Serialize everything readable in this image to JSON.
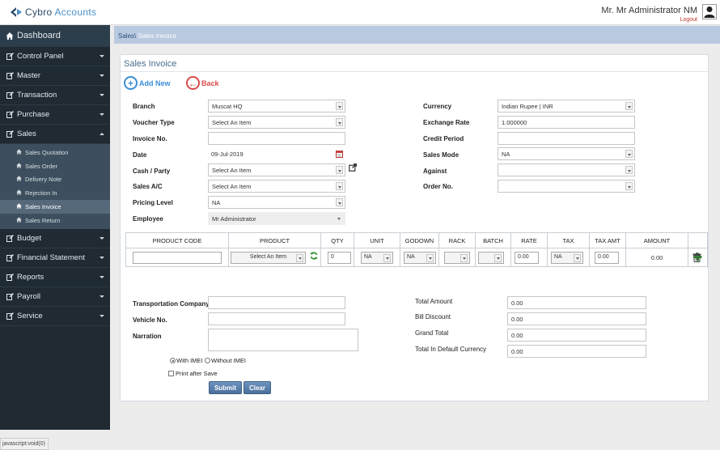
{
  "header": {
    "brand_main": "Cybro",
    "brand_accent": "Accounts",
    "user_name": "Mr. Mr Administrator NM",
    "logout": "Logout"
  },
  "sidebar": {
    "dashboard": "Dashboard",
    "items_top": [
      "Control Panel",
      "Master",
      "Transaction",
      "Purchase",
      "Sales"
    ],
    "sales_sub": [
      "Sales Quotation",
      "Sales Order",
      "Delivery Note",
      "Rejection In",
      "Sales Invoice",
      "Sales Return"
    ],
    "items_bottom": [
      "Budget",
      "Financial Statement",
      "Reports",
      "Payroll",
      "Service"
    ]
  },
  "status_text": "javascript:void(0)",
  "breadcrumb": {
    "parent": "Sales\\",
    "current": "Sales Invoice"
  },
  "panel": {
    "title": "Sales Invoice",
    "add_new": "Add New",
    "back": "Back"
  },
  "form": {
    "branch_label": "Branch",
    "branch_value": "Muscat HQ",
    "voucher_type_label": "Voucher Type",
    "voucher_type_value": "Select An Item",
    "invoice_no_label": "Invoice No.",
    "invoice_no_value": "",
    "date_label": "Date",
    "date_value": "09-Jul-2019",
    "cash_party_label": "Cash / Party",
    "cash_party_value": "Select An Item",
    "sales_ac_label": "Sales A/C",
    "sales_ac_value": "Select An Item",
    "pricing_level_label": "Pricing Level",
    "pricing_level_value": "NA",
    "employee_label": "Employee",
    "employee_value": "Mr Administrator",
    "currency_label": "Currency",
    "currency_value": "Indian Rupee | INR",
    "exchange_rate_label": "Exchange Rate",
    "exchange_rate_value": "1.000000",
    "credit_period_label": "Credit Period",
    "credit_period_value": "",
    "sales_mode_label": "Sales Mode",
    "sales_mode_value": "NA",
    "against_label": "Against",
    "against_value": "",
    "order_no_label": "Order No.",
    "order_no_value": ""
  },
  "grid": {
    "headers": [
      "PRODUCT CODE",
      "PRODUCT",
      "QTY",
      "UNIT",
      "GODOWN",
      "RACK",
      "BATCH",
      "RATE",
      "TAX",
      "TAX AMT",
      "AMOUNT"
    ],
    "row": {
      "product_code": "",
      "product": "Select An Item",
      "qty": "0",
      "unit": "NA",
      "godown": "NA",
      "rack": "",
      "batch": "",
      "rate": "0.00",
      "tax": "NA",
      "tax_amt": "0.00",
      "amount": "0.00"
    }
  },
  "footer": {
    "transport_label": "Transportation Company",
    "transport_value": "",
    "vehicle_label": "Vehicle No.",
    "vehicle_value": "",
    "narration_label": "Narration",
    "narration_value": "",
    "with_imei": "With IMEI",
    "without_imei": "Without IMEI",
    "print_after_save": "Print after Save",
    "total_amount_label": "Total Amount",
    "total_amount_value": "0.00",
    "bill_discount_label": "Bill Discount",
    "bill_discount_value": "0.00",
    "grand_total_label": "Grand Total",
    "grand_total_value": "0.00",
    "total_default_label": "Total In Default Currency",
    "total_default_value": "0.00",
    "submit": "Submit",
    "clear": "Clear"
  },
  "colors": {
    "sidebar_bg": "#1f2a33",
    "breadcrumb_bg": "#b9c9df",
    "add_green": "#2e9b2e",
    "add_blue": "#3a8fd6",
    "back_red": "#d94b4b"
  },
  "icons": [
    "logo-icon",
    "user-icon",
    "home-icon",
    "edit-icon",
    "caret-icon",
    "add-circle-icon",
    "back-circle-icon",
    "calendar-icon",
    "external-link-icon",
    "refresh-icon",
    "add-row-icon",
    "delete-icon"
  ]
}
